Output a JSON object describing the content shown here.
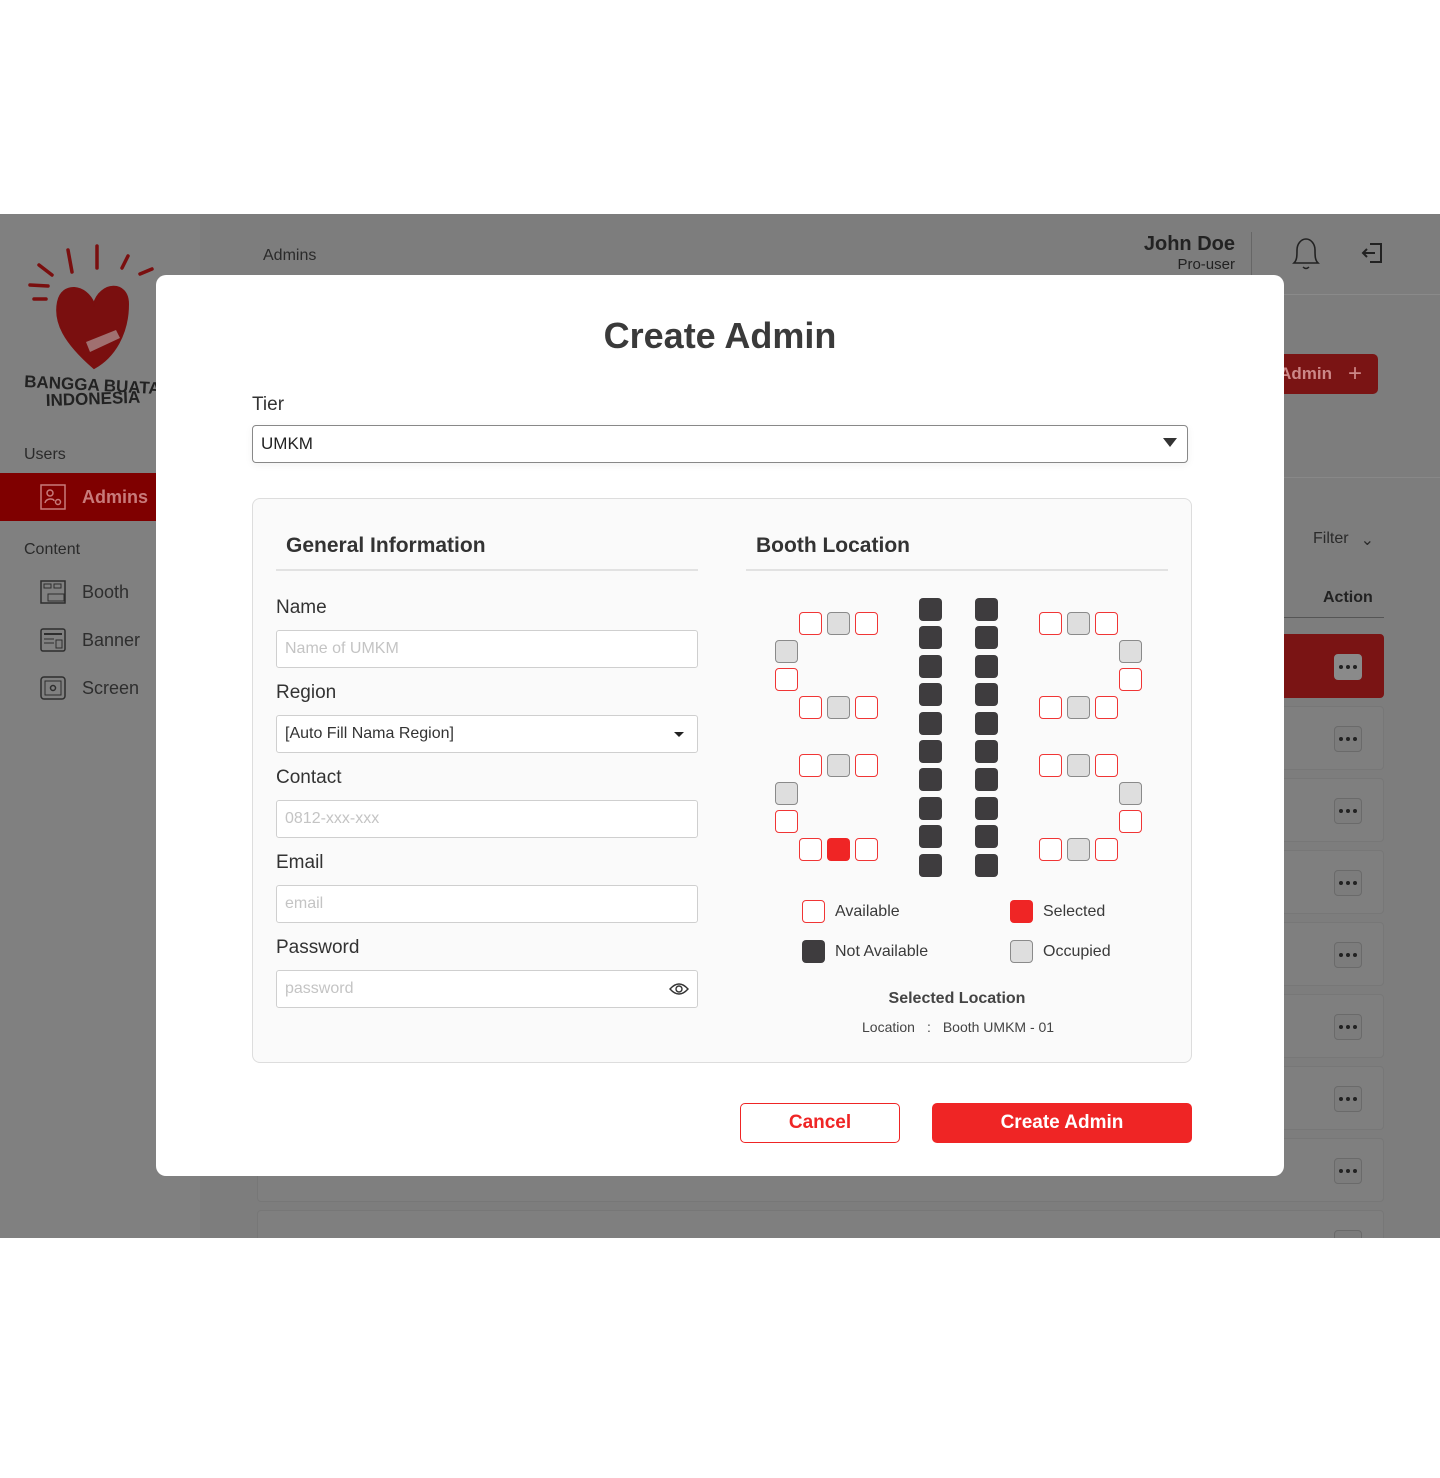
{
  "app": {
    "logo_text": [
      "BANGGA BUATAN",
      "INDONESIA"
    ],
    "breadcrumb": "Admins",
    "user": {
      "name": "John Doe",
      "role": "Pro-user"
    },
    "sidebar": {
      "sections": [
        {
          "label": "Users",
          "items": [
            {
              "label": "Admins",
              "icon": "admin-icon",
              "active": true
            }
          ]
        },
        {
          "label": "Content",
          "items": [
            {
              "label": "Booth",
              "icon": "booth-icon"
            },
            {
              "label": "Banner",
              "icon": "banner-icon"
            },
            {
              "label": "Screen",
              "icon": "screen-icon"
            }
          ]
        }
      ]
    },
    "add_button": "Add Admin",
    "filter": "Filter",
    "table_header_action": "Action"
  },
  "modal": {
    "title": "Create Admin",
    "tier": {
      "label": "Tier",
      "value": "UMKM"
    },
    "general": {
      "heading": "General Information",
      "name": {
        "label": "Name",
        "placeholder": "Name of UMKM"
      },
      "region": {
        "label": "Region",
        "value": "[Auto Fill Nama Region]"
      },
      "contact": {
        "label": "Contact",
        "placeholder": "0812-xxx-xxx"
      },
      "email": {
        "label": "Email",
        "placeholder": "email"
      },
      "password": {
        "label": "Password",
        "placeholder": "password"
      }
    },
    "booth": {
      "heading": "Booth Location",
      "clusters": [
        {
          "top": [
            "available",
            "occupied",
            "available"
          ],
          "side": [
            "occupied",
            "available"
          ],
          "bottom": [
            "available",
            "occupied",
            "available"
          ]
        },
        {
          "top": [
            "available",
            "occupied",
            "available"
          ],
          "side": [
            "occupied",
            "available"
          ],
          "bottom": [
            "available",
            "selected",
            "available"
          ]
        },
        {
          "top": [
            "available",
            "occupied",
            "available"
          ],
          "side": [
            "occupied",
            "available"
          ],
          "bottom": [
            "available",
            "occupied",
            "available"
          ]
        },
        {
          "top": [
            "available",
            "occupied",
            "available"
          ],
          "side": [
            "occupied",
            "available"
          ],
          "bottom": [
            "available",
            "occupied",
            "available"
          ]
        }
      ],
      "center_columns": [
        [
          "not-available",
          "not-available",
          "not-available",
          "not-available",
          "not-available",
          "not-available",
          "not-available",
          "not-available",
          "not-available",
          "not-available"
        ],
        [
          "not-available",
          "not-available",
          "not-available",
          "not-available",
          "not-available",
          "not-available",
          "not-available",
          "not-available",
          "not-available",
          "not-available"
        ]
      ],
      "legend": {
        "available": "Available",
        "selected": "Selected",
        "not_available": "Not Available",
        "occupied": "Occupied"
      },
      "selected_heading": "Selected Location",
      "location_label": "Location",
      "location_sep": ":",
      "location_value": "Booth UMKM - 01"
    },
    "cancel": "Cancel",
    "submit": "Create Admin"
  },
  "colors": {
    "accent": "#ef2525",
    "not_available": "#3e3c3e",
    "occupied": "#dedede"
  }
}
